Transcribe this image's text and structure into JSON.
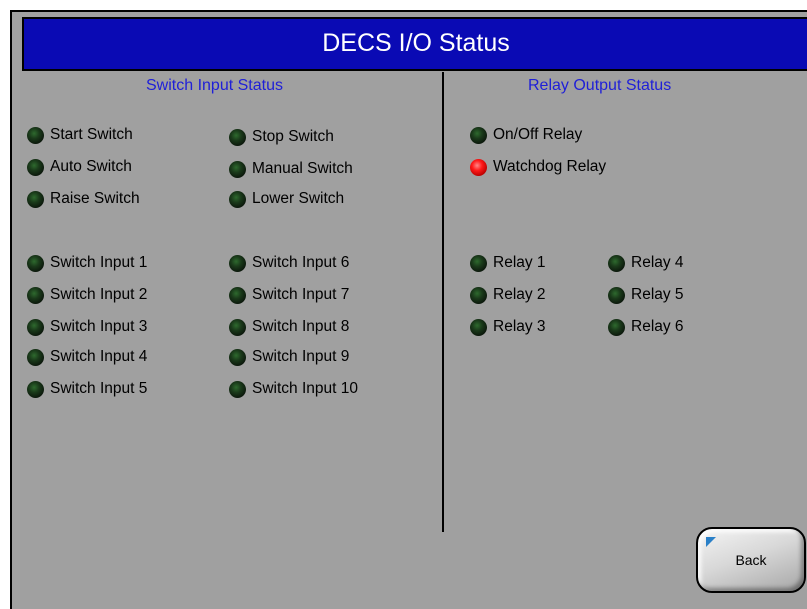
{
  "title": "DECS I/O Status",
  "switch_section": {
    "heading": "Switch Input Status",
    "items": [
      {
        "label": "Start Switch",
        "state": "off"
      },
      {
        "label": "Stop Switch",
        "state": "off"
      },
      {
        "label": "Auto Switch",
        "state": "off"
      },
      {
        "label": "Manual Switch",
        "state": "off"
      },
      {
        "label": "Raise Switch",
        "state": "off"
      },
      {
        "label": "Lower Switch",
        "state": "off"
      },
      {
        "label": "Switch Input 1",
        "state": "off"
      },
      {
        "label": "Switch Input 2",
        "state": "off"
      },
      {
        "label": "Switch Input 3",
        "state": "off"
      },
      {
        "label": "Switch Input 4",
        "state": "off"
      },
      {
        "label": "Switch Input 5",
        "state": "off"
      },
      {
        "label": "Switch Input 6",
        "state": "off"
      },
      {
        "label": "Switch Input 7",
        "state": "off"
      },
      {
        "label": "Switch Input 8",
        "state": "off"
      },
      {
        "label": "Switch Input 9",
        "state": "off"
      },
      {
        "label": "Switch Input 10",
        "state": "off"
      }
    ]
  },
  "relay_section": {
    "heading": "Relay Output Status",
    "items": [
      {
        "label": "On/Off Relay",
        "state": "off"
      },
      {
        "label": "Watchdog Relay",
        "state": "on"
      },
      {
        "label": "Relay 1",
        "state": "off"
      },
      {
        "label": "Relay 2",
        "state": "off"
      },
      {
        "label": "Relay 3",
        "state": "off"
      },
      {
        "label": "Relay 4",
        "state": "off"
      },
      {
        "label": "Relay 5",
        "state": "off"
      },
      {
        "label": "Relay 6",
        "state": "off"
      }
    ]
  },
  "back_button": {
    "label": "Back"
  },
  "colors": {
    "title_bar": "#0a0ab4",
    "heading_text": "#1f1fd8",
    "panel_background": "#a0a0a0",
    "indicator_off": "#0b160b",
    "indicator_on": "#ff1a1a"
  }
}
